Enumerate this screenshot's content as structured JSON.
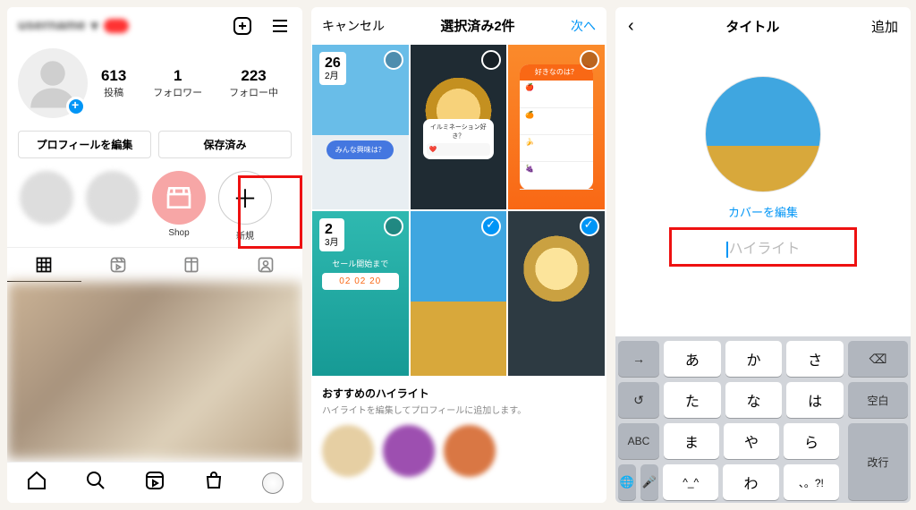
{
  "screen1": {
    "stats": {
      "posts_n": "613",
      "posts_l": "投稿",
      "followers_n": "1",
      "followers_l": "フォロワー",
      "following_n": "223",
      "following_l": "フォロー中"
    },
    "buttons": {
      "edit": "プロフィールを編集",
      "saved": "保存済み"
    },
    "highlights": {
      "shop": "Shop",
      "new": "新規"
    }
  },
  "screen2": {
    "header": {
      "cancel": "キャンセル",
      "title": "選択済み2件",
      "next": "次へ"
    },
    "dates": {
      "d1": "26",
      "m1": "2月",
      "d2": "2",
      "m2": "3月"
    },
    "bubble": "みんな興味は？",
    "sticker_q": "イルミネーション好き？",
    "poll_head": "好きなのは？",
    "countdown_label": "セール開始まで",
    "countdown_digits": "02 02 20",
    "suggested": {
      "title": "おすすめのハイライト",
      "subtitle": "ハイライトを編集してプロフィールに追加します。"
    }
  },
  "screen3": {
    "header": {
      "title": "タイトル",
      "add": "追加"
    },
    "cover_edit": "カバーを編集",
    "placeholder": "ハイライト",
    "keyboard": {
      "r1": [
        "あ",
        "か",
        "さ"
      ],
      "r2": [
        "た",
        "な",
        "は"
      ],
      "r3": [
        "ま",
        "や",
        "ら"
      ],
      "r4": [
        "^_^",
        "わ",
        "、。?!"
      ],
      "arrow": "→",
      "del": "⌫",
      "space": "空白",
      "abc": "ABC",
      "enter": "改行"
    }
  }
}
